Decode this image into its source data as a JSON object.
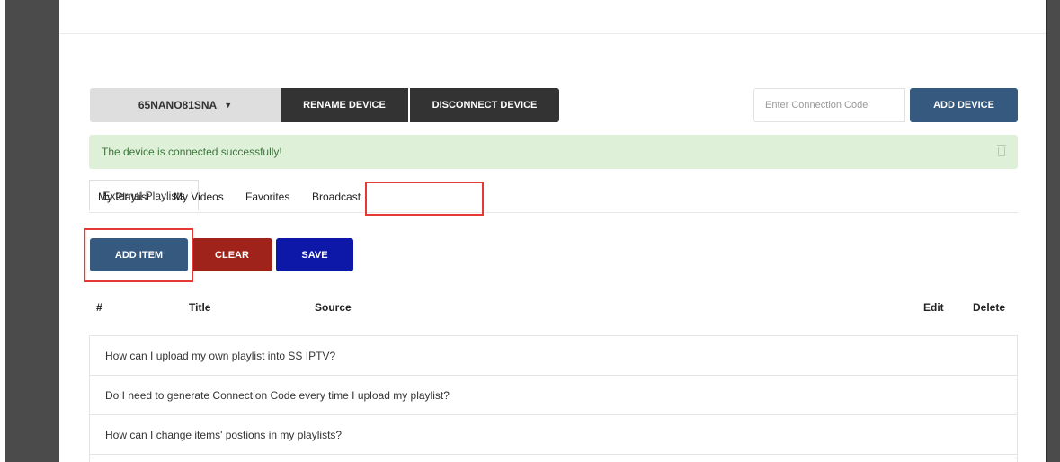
{
  "device": {
    "selected": "65NANO81SNA",
    "rename_label": "RENAME DEVICE",
    "disconnect_label": "DISCONNECT DEVICE"
  },
  "connection": {
    "placeholder": "Enter Connection Code",
    "add_device_label": "ADD DEVICE"
  },
  "alert": {
    "message": "The device is connected successfully!"
  },
  "tabs": [
    {
      "label": "My Playlist"
    },
    {
      "label": "My Videos"
    },
    {
      "label": "Favorites"
    },
    {
      "label": "Broadcast"
    },
    {
      "label": "External Playlists"
    }
  ],
  "actions": {
    "add_item": "ADD ITEM",
    "clear": "CLEAR",
    "save": "SAVE"
  },
  "table": {
    "headers": [
      "#",
      "Title",
      "Source",
      "Edit",
      "Delete"
    ]
  },
  "faq": [
    "How can I upload my own playlist into SS IPTV?",
    "Do I need to generate Connection Code every time I upload my playlist?",
    "How can I change items' postions in my playlists?"
  ],
  "colors": {
    "primary": "#35597f",
    "danger": "#a0231b",
    "save": "#0d18a8",
    "highlight": "#e53935",
    "success_bg": "#dff0d8"
  }
}
